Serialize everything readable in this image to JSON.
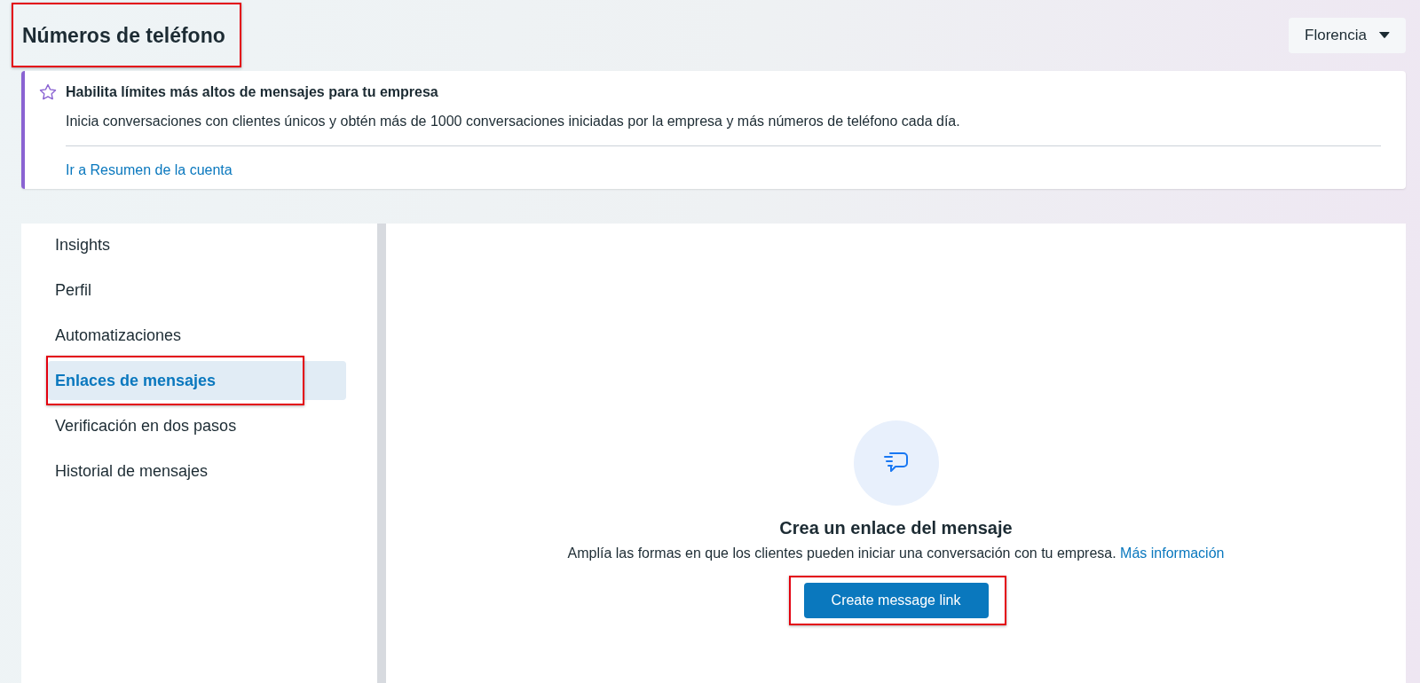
{
  "header": {
    "title": "Números de teléfono",
    "title_highlighted": true,
    "account_menu": {
      "label": "Florencia"
    }
  },
  "banner": {
    "title": "Habilita límites más altos de mensajes para tu empresa",
    "text": "Inicia conversaciones con clientes únicos y obtén más de 1000 conversaciones iniciadas por la empresa y más números de teléfono cada día.",
    "link": "Ir a Resumen de la cuenta"
  },
  "sidebar": {
    "items": [
      {
        "label": "Insights",
        "selected": false,
        "highlighted": false
      },
      {
        "label": "Perfil",
        "selected": false,
        "highlighted": false
      },
      {
        "label": "Automatizaciones",
        "selected": false,
        "highlighted": false
      },
      {
        "label": "Enlaces de mensajes",
        "selected": true,
        "highlighted": true
      },
      {
        "label": "Verificación en dos pasos",
        "selected": false,
        "highlighted": false
      },
      {
        "label": "Historial de mensajes",
        "selected": false,
        "highlighted": false
      }
    ]
  },
  "empty_state": {
    "heading": "Crea un enlace del mensaje",
    "text": "Amplía las formas en que los clientes pueden iniciar una conversación con tu empresa.",
    "link": "Más información",
    "button": {
      "label": "Create message link",
      "highlighted": true
    }
  }
}
